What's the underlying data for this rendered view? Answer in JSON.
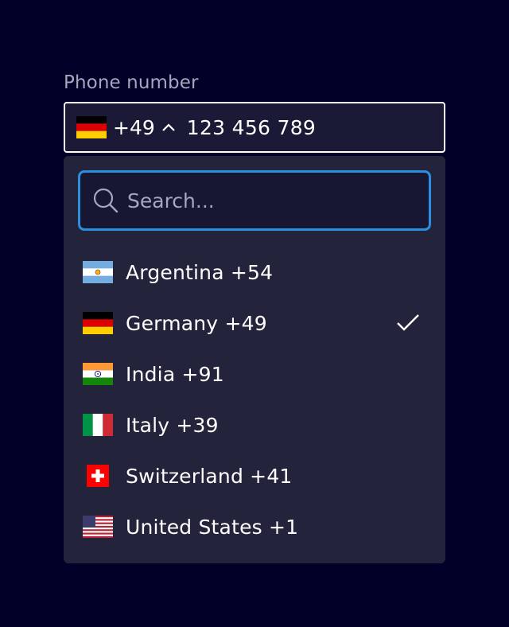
{
  "field": {
    "label": "Phone number",
    "selected_code": "+49",
    "selected_flag": "germany-flag",
    "value": "123 456 789"
  },
  "search": {
    "placeholder": "Search..."
  },
  "options": [
    {
      "label": "Argentina +54",
      "flag": "argentina-flag",
      "selected": false
    },
    {
      "label": "Germany +49",
      "flag": "germany-flag",
      "selected": true
    },
    {
      "label": "India +91",
      "flag": "india-flag",
      "selected": false
    },
    {
      "label": "Italy +39",
      "flag": "italy-flag",
      "selected": false
    },
    {
      "label": "Switzerland +41",
      "flag": "switzerland-flag",
      "selected": false
    },
    {
      "label": "United States +1",
      "flag": "united-states-flag",
      "selected": false
    }
  ],
  "icons": {
    "chevron": "chevron-up-icon",
    "search": "search-icon",
    "check": "checkmark-icon"
  },
  "colors": {
    "background": "#000028",
    "field_bg": "#1a1a36",
    "dropdown_bg": "#23233c",
    "focus_border": "#2b8fe0",
    "label_text": "#a6a6bd",
    "text": "#ffffff"
  }
}
